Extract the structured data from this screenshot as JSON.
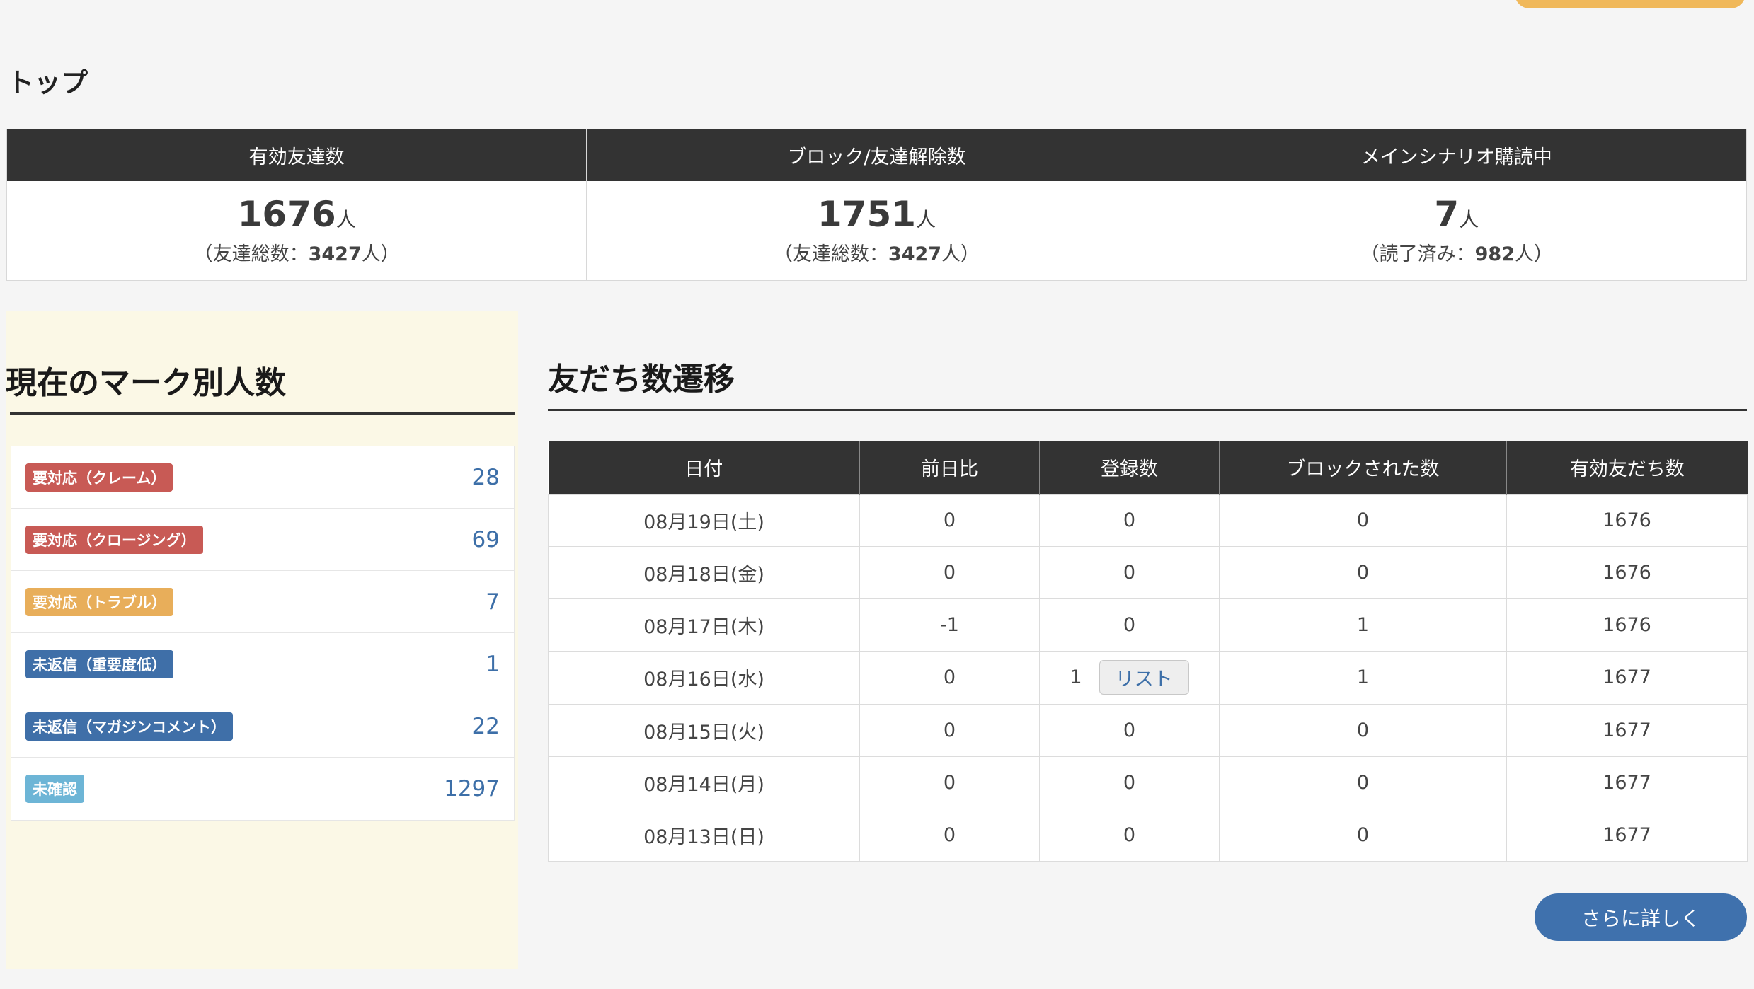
{
  "page_title": "トップ",
  "summary": [
    {
      "header": "有効友達数",
      "value": "1676",
      "unit": "人",
      "sub_prefix": "（友達総数：",
      "sub_value": "3427",
      "sub_suffix": "人）"
    },
    {
      "header": "ブロック/友達解除数",
      "value": "1751",
      "unit": "人",
      "sub_prefix": "（友達総数：",
      "sub_value": "3427",
      "sub_suffix": "人）"
    },
    {
      "header": "メインシナリオ購読中",
      "value": "7",
      "unit": "人",
      "sub_prefix": "（読了済み：",
      "sub_value": "982",
      "sub_suffix": "人）"
    }
  ],
  "marks": {
    "title": "現在のマーク別人数",
    "items": [
      {
        "label": "要対応（クレーム）",
        "count": "28",
        "color": "#c85a55"
      },
      {
        "label": "要対応（クロージング）",
        "count": "69",
        "color": "#c85a55"
      },
      {
        "label": "要対応（トラブル）",
        "count": "7",
        "color": "#e8ae5a"
      },
      {
        "label": "未返信（重要度低）",
        "count": "1",
        "color": "#3f6fa8"
      },
      {
        "label": "未返信（マガジンコメント）",
        "count": "22",
        "color": "#3f6fa8"
      },
      {
        "label": "未確認",
        "count": "1297",
        "color": "#6db5d6"
      }
    ]
  },
  "trend": {
    "title": "友だち数遷移",
    "columns": [
      "日付",
      "前日比",
      "登録数",
      "ブロックされた数",
      "有効友だち数"
    ],
    "rows": [
      {
        "date": "08月19日(土)",
        "diff": "0",
        "reg": "0",
        "blocked": "0",
        "active": "1676"
      },
      {
        "date": "08月18日(金)",
        "diff": "0",
        "reg": "0",
        "blocked": "0",
        "active": "1676"
      },
      {
        "date": "08月17日(木)",
        "diff": "-1",
        "reg": "0",
        "blocked": "1",
        "active": "1676"
      },
      {
        "date": "08月16日(水)",
        "diff": "0",
        "reg": "1",
        "blocked": "1",
        "active": "1677",
        "list_button": "リスト"
      },
      {
        "date": "08月15日(火)",
        "diff": "0",
        "reg": "0",
        "blocked": "0",
        "active": "1677"
      },
      {
        "date": "08月14日(月)",
        "diff": "0",
        "reg": "0",
        "blocked": "0",
        "active": "1677"
      },
      {
        "date": "08月13日(日)",
        "diff": "0",
        "reg": "0",
        "blocked": "0",
        "active": "1677"
      }
    ],
    "more_label": "さらに詳しく"
  }
}
